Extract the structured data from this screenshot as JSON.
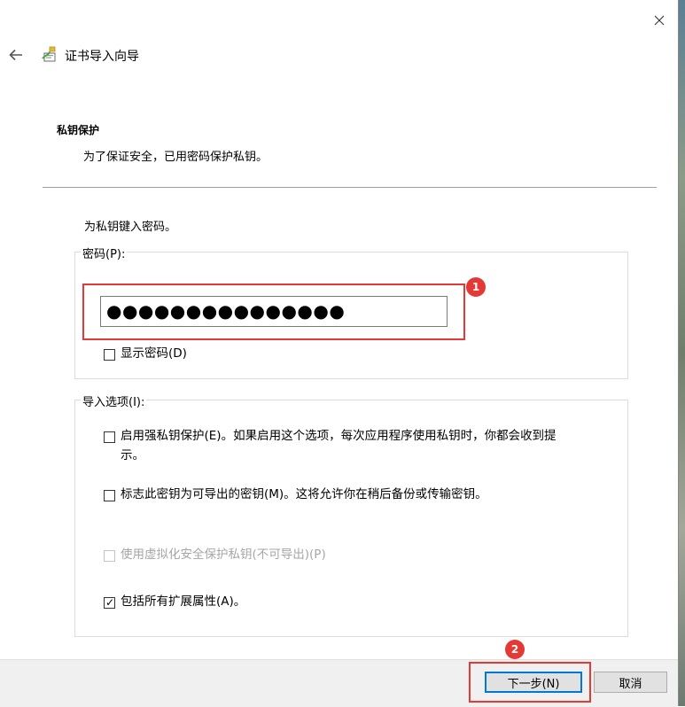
{
  "wizard": {
    "title": "证书导入向导",
    "section_heading": "私钥保护",
    "section_description": "为了保证安全，已用密码保护私钥。",
    "instruction": "为私钥键入密码。"
  },
  "password_group": {
    "label": "密码(P):",
    "password_value": "●●●●●●●●●●●●●●●",
    "show_password_label": "显示密码(D)",
    "show_password_checked": false
  },
  "import_options": {
    "label": "导入选项(I):",
    "options": [
      {
        "label_line1": "启用强私钥保护(E)。如果启用这个选项，每次应用程序使用私钥时，你都会收到提",
        "label_line2": "示。",
        "checked": false,
        "enabled": true
      },
      {
        "label_line1": "标志此密钥为可导出的密钥(M)。这将允许你在稍后备份或传输密钥。",
        "checked": false,
        "enabled": true
      },
      {
        "label_line1": "使用虚拟化安全保护私钥(不可导出)(P)",
        "checked": false,
        "enabled": false
      },
      {
        "label_line1": "包括所有扩展属性(A)。",
        "checked": true,
        "enabled": true
      }
    ]
  },
  "annotations": {
    "badge1": "1",
    "badge2": "2",
    "highlight_color": "#e53935"
  },
  "footer": {
    "next_label": "下一步(N)",
    "cancel_label": "取消"
  },
  "icons": {
    "close": "close-icon",
    "back": "back-arrow-icon",
    "wizard": "certificate-icon",
    "checked": "checkmark-icon"
  },
  "colors": {
    "accent": "#0078d7",
    "annotation_red": "#e53935"
  }
}
